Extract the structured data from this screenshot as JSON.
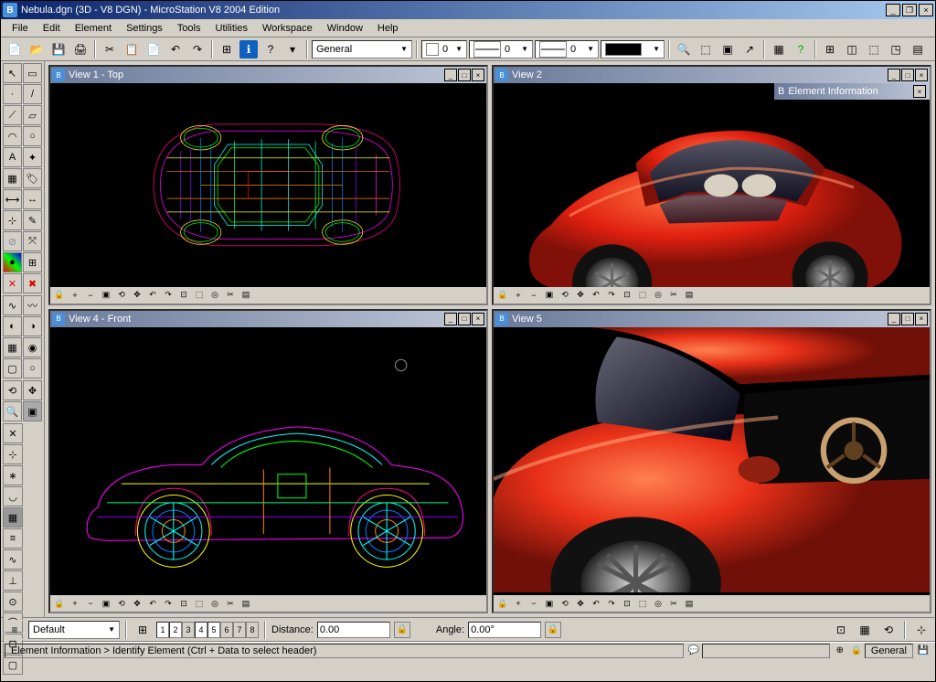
{
  "window": {
    "title": "Nebula.dgn (3D - V8 DGN) - MicroStation V8 2004 Edition"
  },
  "menus": {
    "file": "File",
    "edit": "Edit",
    "element": "Element",
    "settings": "Settings",
    "tools": "Tools",
    "utilities": "Utilities",
    "workspace": "Workspace",
    "window": "Window",
    "help": "Help"
  },
  "main_toolbar": {
    "level_select": "General",
    "color_value": "0",
    "linestyle_value": "0",
    "lineweight_value": "0"
  },
  "viewports": {
    "v1": {
      "title": "View 1 - Top"
    },
    "v2": {
      "title": "View 2"
    },
    "v4": {
      "title": "View 4 - Front"
    },
    "v5": {
      "title": "View 5"
    },
    "info_panel": "Element Information"
  },
  "bottom": {
    "level_select": "Default",
    "view_buttons": [
      "1",
      "2",
      "3",
      "4",
      "5",
      "6",
      "7",
      "8"
    ],
    "active_views": [
      "1",
      "2",
      "4",
      "5"
    ],
    "distance_label": "Distance:",
    "distance_value": "0.00",
    "angle_label": "Angle:",
    "angle_value": "0.00°"
  },
  "statusbar": {
    "prompt": "Element Information > Identify Element (Ctrl + Data to select header)",
    "snap": "General"
  },
  "icons": {
    "new": "📄",
    "open": "📂",
    "save": "💾",
    "print": "🖨",
    "cut": "✂",
    "copy": "📋",
    "paste": "📄",
    "undo": "↶",
    "redo": "↷",
    "info": "ℹ",
    "help": "?",
    "zoom": "🔍",
    "cube": "▢",
    "measure": "📏",
    "min": "_",
    "max": "□",
    "close": "×",
    "restore": "❐"
  }
}
